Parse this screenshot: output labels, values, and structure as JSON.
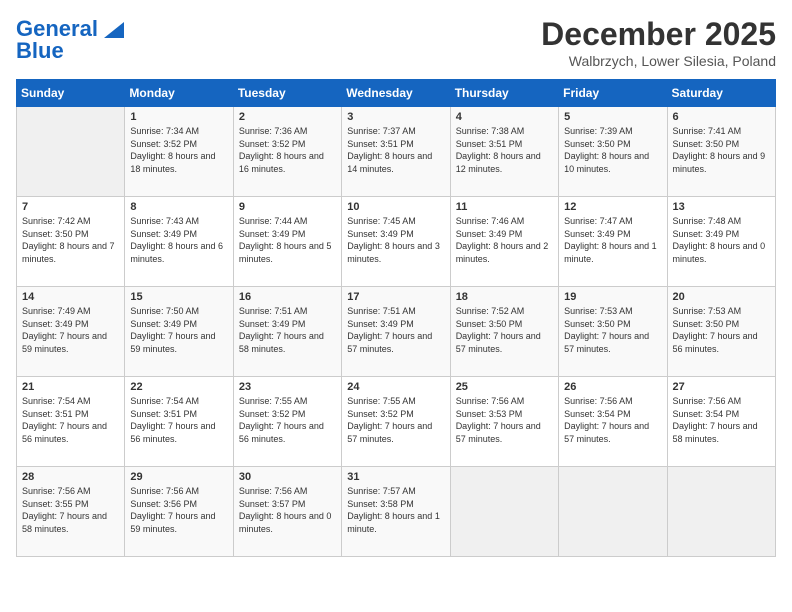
{
  "header": {
    "logo_line1": "General",
    "logo_line2": "Blue",
    "month": "December 2025",
    "location": "Walbrzych, Lower Silesia, Poland"
  },
  "days_of_week": [
    "Sunday",
    "Monday",
    "Tuesday",
    "Wednesday",
    "Thursday",
    "Friday",
    "Saturday"
  ],
  "weeks": [
    [
      {
        "day": "",
        "empty": true
      },
      {
        "day": "1",
        "sunrise": "7:34 AM",
        "sunset": "3:52 PM",
        "daylight": "8 hours and 18 minutes."
      },
      {
        "day": "2",
        "sunrise": "7:36 AM",
        "sunset": "3:52 PM",
        "daylight": "8 hours and 16 minutes."
      },
      {
        "day": "3",
        "sunrise": "7:37 AM",
        "sunset": "3:51 PM",
        "daylight": "8 hours and 14 minutes."
      },
      {
        "day": "4",
        "sunrise": "7:38 AM",
        "sunset": "3:51 PM",
        "daylight": "8 hours and 12 minutes."
      },
      {
        "day": "5",
        "sunrise": "7:39 AM",
        "sunset": "3:50 PM",
        "daylight": "8 hours and 10 minutes."
      },
      {
        "day": "6",
        "sunrise": "7:41 AM",
        "sunset": "3:50 PM",
        "daylight": "8 hours and 9 minutes."
      }
    ],
    [
      {
        "day": "7",
        "sunrise": "7:42 AM",
        "sunset": "3:50 PM",
        "daylight": "8 hours and 7 minutes."
      },
      {
        "day": "8",
        "sunrise": "7:43 AM",
        "sunset": "3:49 PM",
        "daylight": "8 hours and 6 minutes."
      },
      {
        "day": "9",
        "sunrise": "7:44 AM",
        "sunset": "3:49 PM",
        "daylight": "8 hours and 5 minutes."
      },
      {
        "day": "10",
        "sunrise": "7:45 AM",
        "sunset": "3:49 PM",
        "daylight": "8 hours and 3 minutes."
      },
      {
        "day": "11",
        "sunrise": "7:46 AM",
        "sunset": "3:49 PM",
        "daylight": "8 hours and 2 minutes."
      },
      {
        "day": "12",
        "sunrise": "7:47 AM",
        "sunset": "3:49 PM",
        "daylight": "8 hours and 1 minute."
      },
      {
        "day": "13",
        "sunrise": "7:48 AM",
        "sunset": "3:49 PM",
        "daylight": "8 hours and 0 minutes."
      }
    ],
    [
      {
        "day": "14",
        "sunrise": "7:49 AM",
        "sunset": "3:49 PM",
        "daylight": "7 hours and 59 minutes."
      },
      {
        "day": "15",
        "sunrise": "7:50 AM",
        "sunset": "3:49 PM",
        "daylight": "7 hours and 59 minutes."
      },
      {
        "day": "16",
        "sunrise": "7:51 AM",
        "sunset": "3:49 PM",
        "daylight": "7 hours and 58 minutes."
      },
      {
        "day": "17",
        "sunrise": "7:51 AM",
        "sunset": "3:49 PM",
        "daylight": "7 hours and 57 minutes."
      },
      {
        "day": "18",
        "sunrise": "7:52 AM",
        "sunset": "3:50 PM",
        "daylight": "7 hours and 57 minutes."
      },
      {
        "day": "19",
        "sunrise": "7:53 AM",
        "sunset": "3:50 PM",
        "daylight": "7 hours and 57 minutes."
      },
      {
        "day": "20",
        "sunrise": "7:53 AM",
        "sunset": "3:50 PM",
        "daylight": "7 hours and 56 minutes."
      }
    ],
    [
      {
        "day": "21",
        "sunrise": "7:54 AM",
        "sunset": "3:51 PM",
        "daylight": "7 hours and 56 minutes."
      },
      {
        "day": "22",
        "sunrise": "7:54 AM",
        "sunset": "3:51 PM",
        "daylight": "7 hours and 56 minutes."
      },
      {
        "day": "23",
        "sunrise": "7:55 AM",
        "sunset": "3:52 PM",
        "daylight": "7 hours and 56 minutes."
      },
      {
        "day": "24",
        "sunrise": "7:55 AM",
        "sunset": "3:52 PM",
        "daylight": "7 hours and 57 minutes."
      },
      {
        "day": "25",
        "sunrise": "7:56 AM",
        "sunset": "3:53 PM",
        "daylight": "7 hours and 57 minutes."
      },
      {
        "day": "26",
        "sunrise": "7:56 AM",
        "sunset": "3:54 PM",
        "daylight": "7 hours and 57 minutes."
      },
      {
        "day": "27",
        "sunrise": "7:56 AM",
        "sunset": "3:54 PM",
        "daylight": "7 hours and 58 minutes."
      }
    ],
    [
      {
        "day": "28",
        "sunrise": "7:56 AM",
        "sunset": "3:55 PM",
        "daylight": "7 hours and 58 minutes."
      },
      {
        "day": "29",
        "sunrise": "7:56 AM",
        "sunset": "3:56 PM",
        "daylight": "7 hours and 59 minutes."
      },
      {
        "day": "30",
        "sunrise": "7:56 AM",
        "sunset": "3:57 PM",
        "daylight": "8 hours and 0 minutes."
      },
      {
        "day": "31",
        "sunrise": "7:57 AM",
        "sunset": "3:58 PM",
        "daylight": "8 hours and 1 minute."
      },
      {
        "day": "",
        "empty": true
      },
      {
        "day": "",
        "empty": true
      },
      {
        "day": "",
        "empty": true
      }
    ]
  ]
}
